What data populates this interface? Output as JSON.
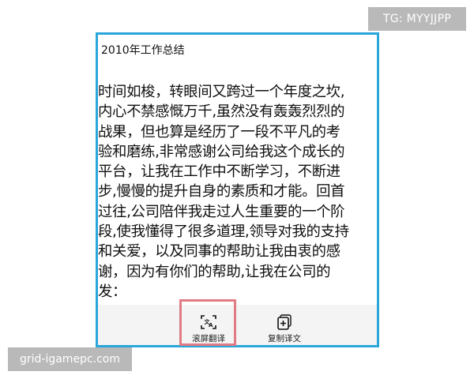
{
  "watermark": {
    "telegram": "TG: MYYJJPP",
    "site": "grid-igamepc.com"
  },
  "document": {
    "title": "2010年工作总结",
    "body_lines": [
      "时间如梭，转眼间又跨过一个年度之坎,",
      "内心不禁感慨万千,虽然没有轰轰烈烈的",
      "战果，但也算是经历了一段不平凡的考",
      "验和磨练,非常感谢公司给我这个成长的",
      "平台，让我在工作中不断学习，不断进",
      "步,慢慢的提升自身的素质和才能。回首",
      "过往,公司陪伴我走过人生重要的一个阶",
      "段,使我懂得了很多道理,领导对我的支持",
      "和关爱，以及同事的帮助让我由衷的感",
      "谢，因为有你们的帮助,让我在公司的",
      "发："
    ]
  },
  "toolbar": {
    "scroll_translate": {
      "label": "滚屏翻译",
      "icon": "scroll-translate-icon"
    },
    "copy_translation": {
      "label": "复制译文",
      "icon": "copy-add-icon"
    }
  },
  "colors": {
    "frame_border": "#2aa6da",
    "highlight": "#e07b85",
    "watermark_bg": "#b9b9b9",
    "toolbar_bg": "#f4f4f4"
  }
}
